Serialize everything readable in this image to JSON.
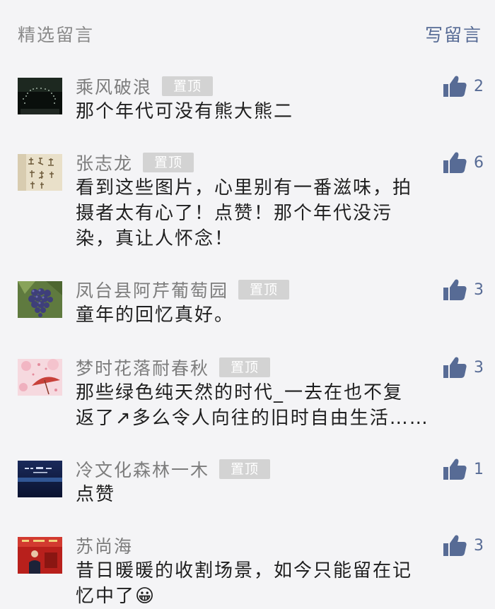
{
  "header": {
    "title": "精选留言",
    "write_label": "写留言"
  },
  "pin_label": "置顶",
  "comments": [
    {
      "name": "乘风破浪",
      "likes": "2",
      "lines": [
        "那个年代可没有熊大熊二"
      ]
    },
    {
      "name": "张志龙",
      "likes": "6",
      "lines": [
        "看到这些图片，心里别有一番滋味，拍",
        "摄者太有心了！点赞！那个年代没污",
        "染，真让人怀念！"
      ]
    },
    {
      "name": "凤台县阿芹葡萄园",
      "likes": "3",
      "lines": [
        "童年的回忆真好。"
      ]
    },
    {
      "name": "梦时花落耐春秋",
      "likes": "3",
      "lines": [
        "那些绿色纯天然的时代_一去在也不复",
        "返了↗多么令人向往的旧时自由生活……"
      ]
    },
    {
      "name": "冷文化森林一木",
      "likes": "1",
      "lines": [
        "点赞"
      ]
    },
    {
      "name": "苏尚海",
      "likes": "3",
      "lines": [
        "昔日暖暖的收割场景，如今只能留在记",
        "忆中了😀"
      ]
    }
  ],
  "colors": {
    "background": "#f4f4f6",
    "accent": "#576b95",
    "name": "#7d7d7d",
    "pin_badge": "#d3d3d3"
  },
  "icons": {
    "like": "thumbs-up-icon"
  }
}
